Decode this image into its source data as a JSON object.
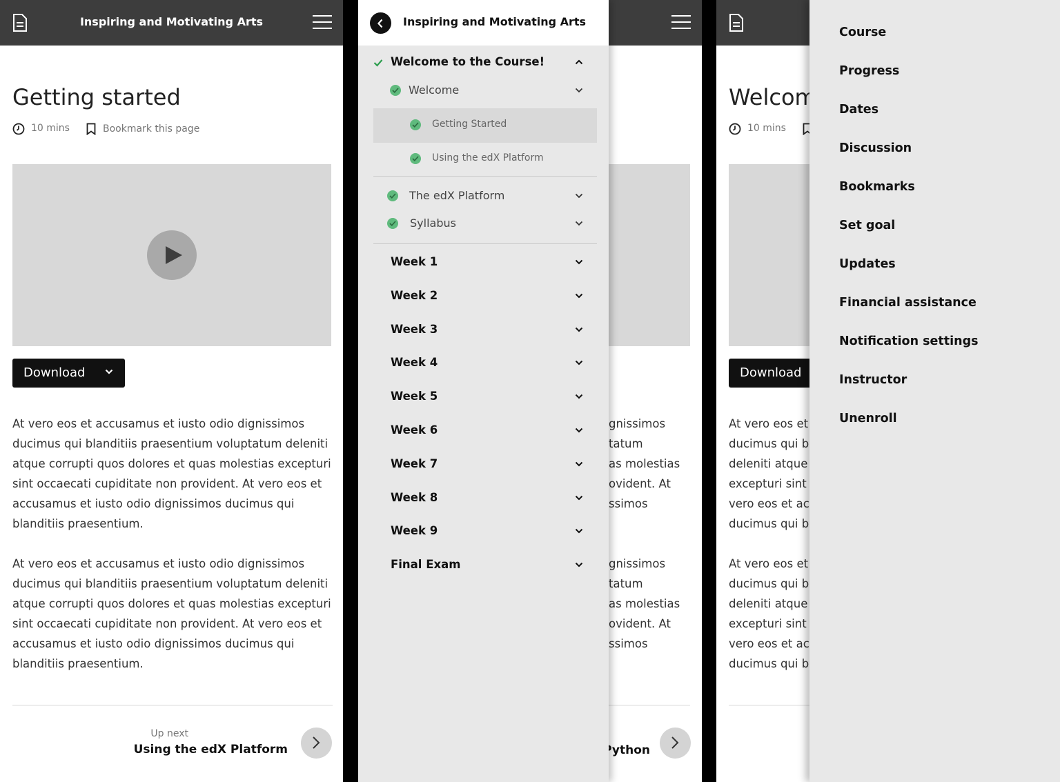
{
  "course_title": "Inspiring and Motivating Arts",
  "screen1": {
    "page_title": "Getting started",
    "duration": "10 mins",
    "bookmark_label": "Bookmark this page",
    "download_label": "Download",
    "paragraphs": [
      "At vero eos et accusamus et iusto odio dignissimos ducimus qui blanditiis praesentium voluptatum deleniti atque corrupti quos dolores et quas molestias excepturi sint occaecati cupiditate non provident. At vero eos et accusamus et iusto odio dignissimos ducimus qui blanditiis praesentium.",
      "At vero eos et accusamus et iusto odio dignissimos ducimus qui blanditiis praesentium voluptatum deleniti atque corrupti quos dolores et quas molestias excepturi sint occaecati cupiditate non provident. At vero eos et accusamus et iusto odio dignissimos ducimus qui blanditiis praesentium."
    ],
    "up_next_label": "Up next",
    "up_next_title": "Using the edX Platform"
  },
  "screen2": {
    "section_title": "Welcome to the Course!",
    "subsection": "Welcome",
    "units": [
      "Getting Started",
      "Using the edX Platform"
    ],
    "subsections": [
      "The edX Platform",
      "Syllabus"
    ],
    "weeks": [
      "Week 1",
      "Week 2",
      "Week 3",
      "Week 4",
      "Week 5",
      "Week 6",
      "Week 7",
      "Week 8",
      "Week 9",
      "Final Exam"
    ],
    "bg_lines_1": [
      "gnissimos",
      "tatum",
      "as molestias",
      "ovident. At",
      "ssimos"
    ],
    "bg_lines_2": [
      "gnissimos",
      "tatum",
      "as molestias",
      "ovident. At",
      "ssimos"
    ],
    "up_next_title_partial": "Python"
  },
  "screen3": {
    "page_title": "Welcome",
    "duration": "10 mins",
    "download_label": "Download",
    "bg_lines_1": [
      "At vero eos et",
      "ducimus qui b",
      "deleniti atque",
      "excepturi sint",
      "vero eos et acc",
      "ducimus qui b"
    ],
    "bg_lines_2": [
      "At vero eos et",
      "ducimus qui b",
      "deleniti atque",
      "excepturi sint",
      "vero eos et acc",
      "ducimus qui b"
    ],
    "menu_items": [
      "Course",
      "Progress",
      "Dates",
      "Discussion",
      "Bookmarks",
      "Set goal",
      "Updates",
      "Financial assistance",
      "Notification settings",
      "Instructor",
      "Unenroll"
    ]
  },
  "colors": {
    "topbar": "#3d3d3d",
    "check_green": "#5fba7d",
    "drawer_bg": "#e8e8e8",
    "video_bg": "#d8d8d8"
  }
}
